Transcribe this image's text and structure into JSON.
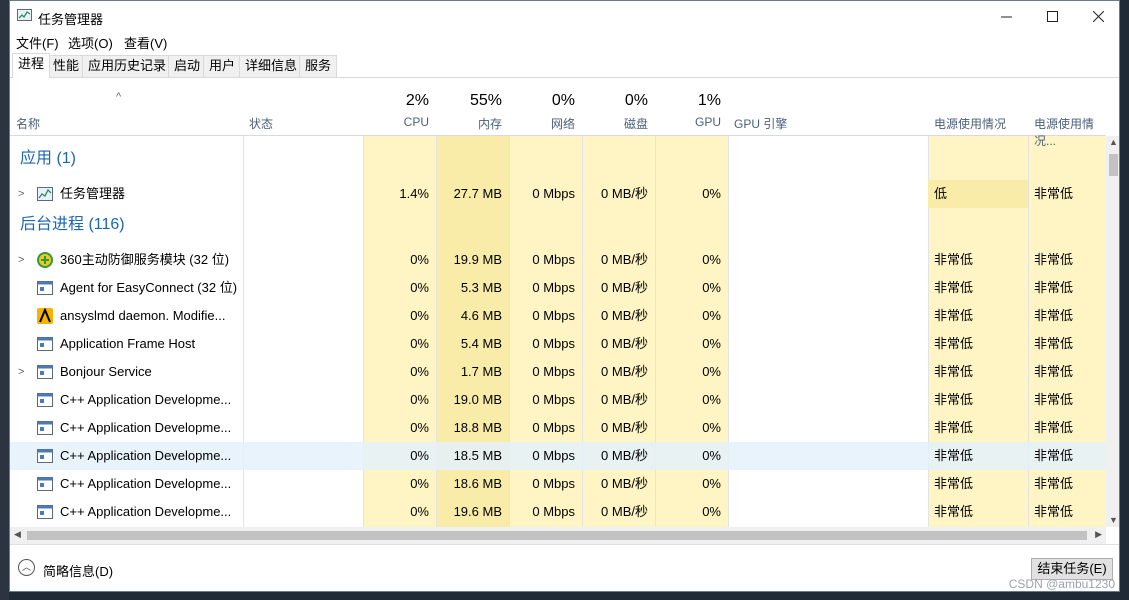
{
  "window": {
    "title": "任务管理器",
    "minimize_icon": "minimize-icon",
    "maximize_icon": "maximize-icon",
    "close_icon": "close-icon"
  },
  "menu": [
    "文件(F)",
    "选项(O)",
    "查看(V)"
  ],
  "tabs": [
    "进程",
    "性能",
    "应用历史记录",
    "启动",
    "用户",
    "详细信息",
    "服务"
  ],
  "active_tab": "进程",
  "columns": {
    "name": "名称",
    "status": "状态",
    "cpu": {
      "pct": "2%",
      "label": "CPU"
    },
    "memory": {
      "pct": "55%",
      "label": "内存"
    },
    "network": {
      "pct": "0%",
      "label": "网络"
    },
    "disk": {
      "pct": "0%",
      "label": "磁盘"
    },
    "gpu": {
      "pct": "1%",
      "label": "GPU"
    },
    "gpu_engine": "GPU 引擎",
    "power": "电源使用情况",
    "power_trend": "电源使用情况..."
  },
  "groups": [
    {
      "title": "应用 (1)",
      "rows": [
        {
          "name": "任务管理器",
          "expandable": true,
          "icon": "taskmgr-icon",
          "cpu": "1.4%",
          "mem": "27.7 MB",
          "net": "0 Mbps",
          "disk": "0 MB/秒",
          "gpu": "0%",
          "power": "低",
          "trend": "非常低"
        }
      ]
    },
    {
      "title": "后台进程 (116)",
      "rows": [
        {
          "name": "360主动防御服务模块 (32 位)",
          "expandable": true,
          "icon": "360-icon",
          "cpu": "0%",
          "mem": "19.9 MB",
          "net": "0 Mbps",
          "disk": "0 MB/秒",
          "gpu": "0%",
          "power": "非常低",
          "trend": "非常低"
        },
        {
          "name": "Agent for EasyConnect (32 位)",
          "expandable": false,
          "icon": "window-icon",
          "cpu": "0%",
          "mem": "5.3 MB",
          "net": "0 Mbps",
          "disk": "0 MB/秒",
          "gpu": "0%",
          "power": "非常低",
          "trend": "非常低"
        },
        {
          "name": "ansyslmd daemon.  Modifie...",
          "expandable": false,
          "icon": "ansys-icon",
          "cpu": "0%",
          "mem": "4.6 MB",
          "net": "0 Mbps",
          "disk": "0 MB/秒",
          "gpu": "0%",
          "power": "非常低",
          "trend": "非常低"
        },
        {
          "name": "Application Frame Host",
          "expandable": false,
          "icon": "window-icon",
          "cpu": "0%",
          "mem": "5.4 MB",
          "net": "0 Mbps",
          "disk": "0 MB/秒",
          "gpu": "0%",
          "power": "非常低",
          "trend": "非常低"
        },
        {
          "name": "Bonjour Service",
          "expandable": true,
          "icon": "window-icon",
          "cpu": "0%",
          "mem": "1.7 MB",
          "net": "0 Mbps",
          "disk": "0 MB/秒",
          "gpu": "0%",
          "power": "非常低",
          "trend": "非常低"
        },
        {
          "name": "C++ Application Developme...",
          "expandable": false,
          "icon": "window-icon",
          "cpu": "0%",
          "mem": "19.0 MB",
          "net": "0 Mbps",
          "disk": "0 MB/秒",
          "gpu": "0%",
          "power": "非常低",
          "trend": "非常低"
        },
        {
          "name": "C++ Application Developme...",
          "expandable": false,
          "icon": "window-icon",
          "cpu": "0%",
          "mem": "18.8 MB",
          "net": "0 Mbps",
          "disk": "0 MB/秒",
          "gpu": "0%",
          "power": "非常低",
          "trend": "非常低"
        },
        {
          "name": "C++ Application Developme...",
          "expandable": false,
          "icon": "window-icon",
          "cpu": "0%",
          "mem": "18.5 MB",
          "net": "0 Mbps",
          "disk": "0 MB/秒",
          "gpu": "0%",
          "power": "非常低",
          "trend": "非常低",
          "selected": true
        },
        {
          "name": "C++ Application Developme...",
          "expandable": false,
          "icon": "window-icon",
          "cpu": "0%",
          "mem": "18.6 MB",
          "net": "0 Mbps",
          "disk": "0 MB/秒",
          "gpu": "0%",
          "power": "非常低",
          "trend": "非常低"
        },
        {
          "name": "C++ Application Developme...",
          "expandable": false,
          "icon": "window-icon",
          "cpu": "0%",
          "mem": "19.6 MB",
          "net": "0 Mbps",
          "disk": "0 MB/秒",
          "gpu": "0%",
          "power": "非常低",
          "trend": "非常低"
        }
      ]
    }
  ],
  "footer": {
    "collapse_label": "简略信息(D)",
    "end_task_label": "结束任务(E)"
  },
  "watermark": "CSDN @ambu1230",
  "colors": {
    "heat_light": "#fff4c4",
    "heat_medium": "#f9eca8",
    "group_title": "#1b66b0",
    "selected_row": "#e5f1fb"
  }
}
